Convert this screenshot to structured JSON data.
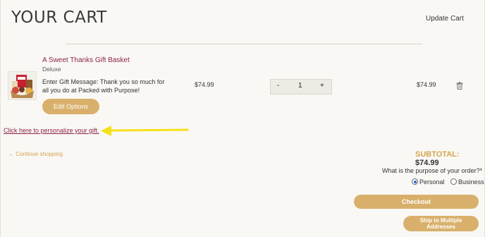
{
  "header": {
    "title": "YOUR CART",
    "update_cart": "Update Cart"
  },
  "cart_item": {
    "name": "A Sweet Thanks Gift Basket",
    "variant": "Deluxe",
    "gift_message": "Enter Gift Message: Thank you so much for all you do at Packed with Purpose!",
    "edit_options": "Edit Options",
    "price": "$74.99",
    "quantity": {
      "minus": "-",
      "value": "1",
      "plus": "+"
    },
    "line_total": "$74.99",
    "remove_icon": "trash-icon"
  },
  "personalize_link": "Click here to personalize your gift.",
  "annotation": {
    "arrow_color": "#f5e11a",
    "direction": "left"
  },
  "continue_link": "← Continue shopping",
  "subtotal": {
    "label": "SUBTOTAL:",
    "value": "$74.99"
  },
  "purpose": {
    "question": "What is the purpose of your order?*",
    "options": [
      {
        "label": "Personal",
        "selected": true
      },
      {
        "label": "Business",
        "selected": false
      }
    ]
  },
  "buttons": {
    "checkout": "Checkout",
    "ship_multiple": "Ship to Multiple Addresses"
  },
  "colors": {
    "accent": "#d9b06b",
    "link": "#8a2346",
    "continue": "#d4a44f",
    "background": "#faf8f5"
  }
}
